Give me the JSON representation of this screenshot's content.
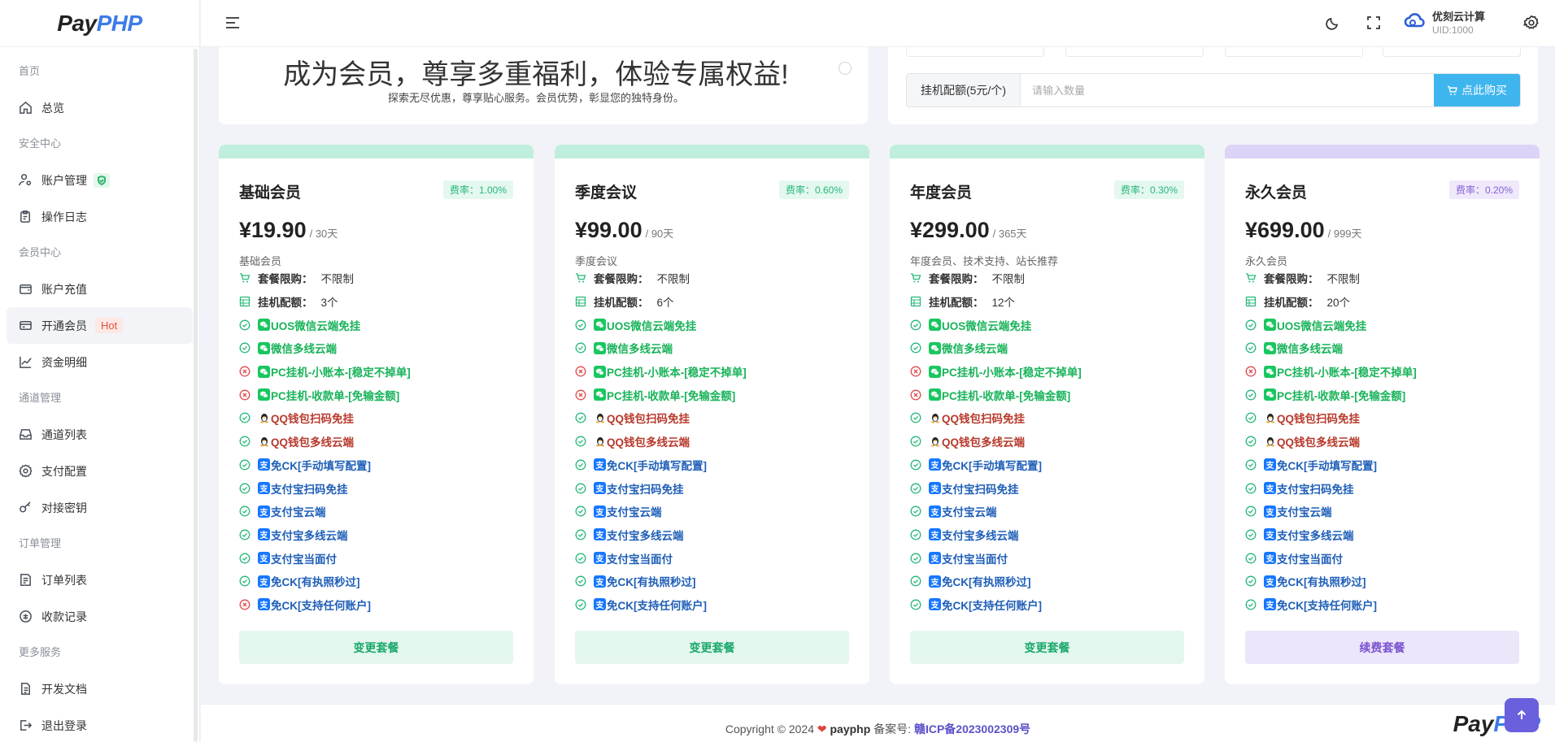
{
  "brand": {
    "pay": "Pay",
    "php": "PHP"
  },
  "sidebar": {
    "sections": [
      {
        "title": "首页",
        "items": [
          {
            "label": "总览",
            "icon": "home-icon"
          }
        ]
      },
      {
        "title": "安全中心",
        "items": [
          {
            "label": "账户管理",
            "icon": "user-cog-icon"
          },
          {
            "label": "操作日志",
            "icon": "clipboard-icon"
          }
        ]
      },
      {
        "title": "会员中心",
        "items": [
          {
            "label": "账户充值",
            "icon": "wallet-icon"
          },
          {
            "label": "开通会员",
            "icon": "card-icon",
            "badge": "Hot"
          },
          {
            "label": "资金明细",
            "icon": "chart-line-icon"
          }
        ]
      },
      {
        "title": "通道管理",
        "items": [
          {
            "label": "通道列表",
            "icon": "inbox-icon"
          },
          {
            "label": "支付配置",
            "icon": "settings-icon"
          },
          {
            "label": "对接密钥",
            "icon": "key-icon"
          }
        ]
      },
      {
        "title": "订单管理",
        "items": [
          {
            "label": "订单列表",
            "icon": "order-icon"
          },
          {
            "label": "收款记录",
            "icon": "receipt-icon"
          }
        ]
      },
      {
        "title": "更多服务",
        "items": [
          {
            "label": "开发文档",
            "icon": "doc-icon"
          },
          {
            "label": "退出登录",
            "icon": "logout-icon"
          }
        ]
      }
    ]
  },
  "header": {
    "user_name": "优刻云计算",
    "user_uid": "UID:1000"
  },
  "banner": {
    "title": "成为会员，尊享多重福利，体验专属权益!",
    "subtitle": "探索无尽优惠，尊享贴心服务。会员优势，彰显您的独特身份。"
  },
  "buy": {
    "label": "挂机配额(5元/个)",
    "placeholder": "请输入数量",
    "button": "点此购买"
  },
  "plans": [
    {
      "name": "基础会员",
      "rate": "费率：1.00%",
      "price": "¥19.90",
      "period": "/ 30天",
      "desc": "基础会员",
      "limit_k": "套餐限购：",
      "limit_v": "不限制",
      "quota_k": "挂机配额：",
      "quota_v": "3个",
      "button": "变更套餐",
      "features": [
        {
          "ok": true,
          "app": "wx",
          "text": "UOS微信云端免挂",
          "color": "green"
        },
        {
          "ok": true,
          "app": "wx",
          "text": "微信多线云端",
          "color": "green"
        },
        {
          "ok": false,
          "app": "wx",
          "text": "PC挂机-小账本-[稳定不掉单]",
          "color": "green"
        },
        {
          "ok": false,
          "app": "wx",
          "text": "PC挂机-收款单-[免输金额]",
          "color": "green"
        },
        {
          "ok": true,
          "app": "qq",
          "text": "QQ钱包扫码免挂",
          "color": "red"
        },
        {
          "ok": true,
          "app": "qq",
          "text": "QQ钱包多线云端",
          "color": "red"
        },
        {
          "ok": true,
          "app": "ali",
          "text": "免CK[手动填写配置]",
          "color": "blue"
        },
        {
          "ok": true,
          "app": "ali",
          "text": "支付宝扫码免挂",
          "color": "blue"
        },
        {
          "ok": true,
          "app": "ali",
          "text": "支付宝云端",
          "color": "blue"
        },
        {
          "ok": true,
          "app": "ali",
          "text": "支付宝多线云端",
          "color": "blue"
        },
        {
          "ok": true,
          "app": "ali",
          "text": "支付宝当面付",
          "color": "blue"
        },
        {
          "ok": true,
          "app": "ali",
          "text": "免CK[有执照秒过]",
          "color": "blue"
        },
        {
          "ok": false,
          "app": "ali",
          "text": "免CK[支持任何账户]",
          "color": "blue"
        }
      ]
    },
    {
      "name": "季度会议",
      "rate": "费率：0.60%",
      "price": "¥99.00",
      "period": "/ 90天",
      "desc": "季度会议",
      "limit_k": "套餐限购：",
      "limit_v": "不限制",
      "quota_k": "挂机配额：",
      "quota_v": "6个",
      "button": "变更套餐",
      "features": [
        {
          "ok": true,
          "app": "wx",
          "text": "UOS微信云端免挂",
          "color": "green"
        },
        {
          "ok": true,
          "app": "wx",
          "text": "微信多线云端",
          "color": "green"
        },
        {
          "ok": false,
          "app": "wx",
          "text": "PC挂机-小账本-[稳定不掉单]",
          "color": "green"
        },
        {
          "ok": false,
          "app": "wx",
          "text": "PC挂机-收款单-[免输金额]",
          "color": "green"
        },
        {
          "ok": true,
          "app": "qq",
          "text": "QQ钱包扫码免挂",
          "color": "red"
        },
        {
          "ok": true,
          "app": "qq",
          "text": "QQ钱包多线云端",
          "color": "red"
        },
        {
          "ok": true,
          "app": "ali",
          "text": "免CK[手动填写配置]",
          "color": "blue"
        },
        {
          "ok": true,
          "app": "ali",
          "text": "支付宝扫码免挂",
          "color": "blue"
        },
        {
          "ok": true,
          "app": "ali",
          "text": "支付宝云端",
          "color": "blue"
        },
        {
          "ok": true,
          "app": "ali",
          "text": "支付宝多线云端",
          "color": "blue"
        },
        {
          "ok": true,
          "app": "ali",
          "text": "支付宝当面付",
          "color": "blue"
        },
        {
          "ok": true,
          "app": "ali",
          "text": "免CK[有执照秒过]",
          "color": "blue"
        },
        {
          "ok": true,
          "app": "ali",
          "text": "免CK[支持任何账户]",
          "color": "blue"
        }
      ]
    },
    {
      "name": "年度会员",
      "rate": "费率：0.30%",
      "price": "¥299.00",
      "period": "/ 365天",
      "desc": "年度会员、技术支持、站长推荐",
      "limit_k": "套餐限购：",
      "limit_v": "不限制",
      "quota_k": "挂机配额：",
      "quota_v": "12个",
      "button": "变更套餐",
      "features": [
        {
          "ok": true,
          "app": "wx",
          "text": "UOS微信云端免挂",
          "color": "green"
        },
        {
          "ok": true,
          "app": "wx",
          "text": "微信多线云端",
          "color": "green"
        },
        {
          "ok": false,
          "app": "wx",
          "text": "PC挂机-小账本-[稳定不掉单]",
          "color": "green"
        },
        {
          "ok": false,
          "app": "wx",
          "text": "PC挂机-收款单-[免输金额]",
          "color": "green"
        },
        {
          "ok": true,
          "app": "qq",
          "text": "QQ钱包扫码免挂",
          "color": "red"
        },
        {
          "ok": true,
          "app": "qq",
          "text": "QQ钱包多线云端",
          "color": "red"
        },
        {
          "ok": true,
          "app": "ali",
          "text": "免CK[手动填写配置]",
          "color": "blue"
        },
        {
          "ok": true,
          "app": "ali",
          "text": "支付宝扫码免挂",
          "color": "blue"
        },
        {
          "ok": true,
          "app": "ali",
          "text": "支付宝云端",
          "color": "blue"
        },
        {
          "ok": true,
          "app": "ali",
          "text": "支付宝多线云端",
          "color": "blue"
        },
        {
          "ok": true,
          "app": "ali",
          "text": "支付宝当面付",
          "color": "blue"
        },
        {
          "ok": true,
          "app": "ali",
          "text": "免CK[有执照秒过]",
          "color": "blue"
        },
        {
          "ok": true,
          "app": "ali",
          "text": "免CK[支持任何账户]",
          "color": "blue"
        }
      ]
    },
    {
      "name": "永久会员",
      "rate": "费率：0.20%",
      "price": "¥699.00",
      "period": "/ 999天",
      "desc": "永久会员",
      "limit_k": "套餐限购：",
      "limit_v": "不限制",
      "quota_k": "挂机配额：",
      "quota_v": "20个",
      "button": "续费套餐",
      "features": [
        {
          "ok": true,
          "app": "wx",
          "text": "UOS微信云端免挂",
          "color": "green"
        },
        {
          "ok": true,
          "app": "wx",
          "text": "微信多线云端",
          "color": "green"
        },
        {
          "ok": false,
          "app": "wx",
          "text": "PC挂机-小账本-[稳定不掉单]",
          "color": "green"
        },
        {
          "ok": true,
          "app": "wx",
          "text": "PC挂机-收款单-[免输金额]",
          "color": "green"
        },
        {
          "ok": true,
          "app": "qq",
          "text": "QQ钱包扫码免挂",
          "color": "red"
        },
        {
          "ok": true,
          "app": "qq",
          "text": "QQ钱包多线云端",
          "color": "red"
        },
        {
          "ok": true,
          "app": "ali",
          "text": "免CK[手动填写配置]",
          "color": "blue"
        },
        {
          "ok": true,
          "app": "ali",
          "text": "支付宝扫码免挂",
          "color": "blue"
        },
        {
          "ok": true,
          "app": "ali",
          "text": "支付宝云端",
          "color": "blue"
        },
        {
          "ok": true,
          "app": "ali",
          "text": "支付宝多线云端",
          "color": "blue"
        },
        {
          "ok": true,
          "app": "ali",
          "text": "支付宝当面付",
          "color": "blue"
        },
        {
          "ok": true,
          "app": "ali",
          "text": "免CK[有执照秒过]",
          "color": "blue"
        },
        {
          "ok": true,
          "app": "ali",
          "text": "免CK[支持任何账户]",
          "color": "blue"
        }
      ]
    }
  ],
  "footer": {
    "prefix": "Copyright © 2024",
    "brand": "payphp",
    "icp_label": "备案号:",
    "icp": "赣ICP备2023002309号"
  },
  "colors": {
    "accent_green": "#19b35a",
    "accent_blue": "#3fb5ee",
    "accent_purple": "#7a52d0",
    "hot": "#e0533f"
  }
}
